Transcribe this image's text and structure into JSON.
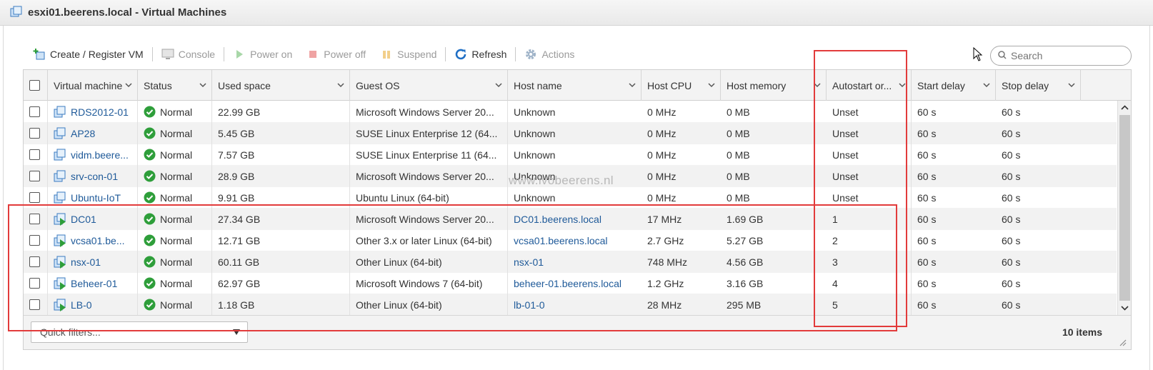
{
  "window": {
    "title": "esxi01.beerens.local - Virtual Machines"
  },
  "toolbar": {
    "create": "Create / Register VM",
    "console": "Console",
    "power_on": "Power on",
    "power_off": "Power off",
    "suspend": "Suspend",
    "refresh": "Refresh",
    "actions": "Actions"
  },
  "search": {
    "placeholder": "Search"
  },
  "columns": [
    "Virtual machine",
    "Status",
    "Used space",
    "Guest OS",
    "Host name",
    "Host CPU",
    "Host memory",
    "Autostart or...",
    "Start delay",
    "Stop delay"
  ],
  "rows": [
    {
      "name": "RDS2012-01",
      "status": "Normal",
      "used": "22.99 GB",
      "os": "Microsoft Windows Server 20...",
      "host": "Unknown",
      "cpu": "0 MHz",
      "mem": "0 MB",
      "autostart": "Unset",
      "start": "60 s",
      "stop": "60 s",
      "powered": "off"
    },
    {
      "name": "AP28",
      "status": "Normal",
      "used": "5.45 GB",
      "os": "SUSE Linux Enterprise 12 (64...",
      "host": "Unknown",
      "cpu": "0 MHz",
      "mem": "0 MB",
      "autostart": "Unset",
      "start": "60 s",
      "stop": "60 s",
      "powered": "off"
    },
    {
      "name": "vidm.beere...",
      "status": "Normal",
      "used": "7.57 GB",
      "os": "SUSE Linux Enterprise 11 (64...",
      "host": "Unknown",
      "cpu": "0 MHz",
      "mem": "0 MB",
      "autostart": "Unset",
      "start": "60 s",
      "stop": "60 s",
      "powered": "off"
    },
    {
      "name": "srv-con-01",
      "status": "Normal",
      "used": "28.9 GB",
      "os": "Microsoft Windows Server 20...",
      "host": "Unknown",
      "cpu": "0 MHz",
      "mem": "0 MB",
      "autostart": "Unset",
      "start": "60 s",
      "stop": "60 s",
      "powered": "off"
    },
    {
      "name": "Ubuntu-IoT",
      "status": "Normal",
      "used": "9.91 GB",
      "os": "Ubuntu Linux (64-bit)",
      "host": "Unknown",
      "cpu": "0 MHz",
      "mem": "0 MB",
      "autostart": "Unset",
      "start": "60 s",
      "stop": "60 s",
      "powered": "off"
    },
    {
      "name": "DC01",
      "status": "Normal",
      "used": "27.34 GB",
      "os": "Microsoft Windows Server 20...",
      "host": "DC01.beerens.local",
      "cpu": "17 MHz",
      "mem": "1.69 GB",
      "autostart": "1",
      "start": "60 s",
      "stop": "60 s",
      "powered": "on"
    },
    {
      "name": "vcsa01.be...",
      "status": "Normal",
      "used": "12.71 GB",
      "os": "Other 3.x or later Linux (64-bit)",
      "host": "vcsa01.beerens.local",
      "cpu": "2.7 GHz",
      "mem": "5.27 GB",
      "autostart": "2",
      "start": "60 s",
      "stop": "60 s",
      "powered": "on"
    },
    {
      "name": "nsx-01",
      "status": "Normal",
      "used": "60.11 GB",
      "os": "Other Linux (64-bit)",
      "host": "nsx-01",
      "cpu": "748 MHz",
      "mem": "4.56 GB",
      "autostart": "3",
      "start": "60 s",
      "stop": "60 s",
      "powered": "on"
    },
    {
      "name": "Beheer-01",
      "status": "Normal",
      "used": "62.97 GB",
      "os": "Microsoft Windows 7 (64-bit)",
      "host": "beheer-01.beerens.local",
      "cpu": "1.2 GHz",
      "mem": "3.16 GB",
      "autostart": "4",
      "start": "60 s",
      "stop": "60 s",
      "powered": "on"
    },
    {
      "name": "LB-0",
      "status": "Normal",
      "used": "1.18 GB",
      "os": "Other Linux (64-bit)",
      "host": "lb-01-0",
      "cpu": "28 MHz",
      "mem": "295 MB",
      "autostart": "5",
      "start": "60 s",
      "stop": "60 s",
      "powered": "on"
    }
  ],
  "footer": {
    "quick_filters": "Quick filters...",
    "count": "10 items"
  },
  "watermark": "www.ivobeerens.nl",
  "colors": {
    "link": "#1f5a99",
    "highlight": "#e23b3b",
    "ok": "#2e9e3a"
  }
}
